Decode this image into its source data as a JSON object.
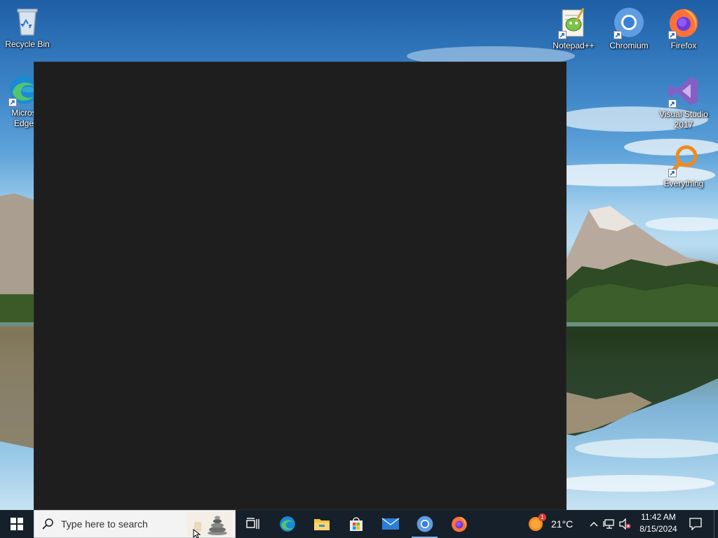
{
  "desktop": {
    "icons": [
      {
        "id": "recycle-bin",
        "label": "Recycle Bin",
        "icon": "recycle-bin-icon"
      },
      {
        "id": "edge",
        "label": "Micros\nEdge",
        "icon": "edge-icon"
      },
      {
        "id": "notepadpp",
        "label": "Notepad++",
        "icon": "notepadpp-icon"
      },
      {
        "id": "chromium",
        "label": "Chromium",
        "icon": "chromium-icon"
      },
      {
        "id": "firefox",
        "label": "Firefox",
        "icon": "firefox-icon"
      },
      {
        "id": "visual-studio",
        "label": "Visual Studio\n2017",
        "icon": "visual-studio-icon"
      },
      {
        "id": "everything",
        "label": "Everything",
        "icon": "everything-icon"
      }
    ]
  },
  "taskbar": {
    "search_placeholder": "Type here to search",
    "apps": [
      {
        "name": "Task View",
        "icon": "task-view-icon"
      },
      {
        "name": "Microsoft Edge",
        "icon": "edge-icon"
      },
      {
        "name": "File Explorer",
        "icon": "file-explorer-icon"
      },
      {
        "name": "Microsoft Store",
        "icon": "store-icon"
      },
      {
        "name": "Mail",
        "icon": "mail-icon"
      },
      {
        "name": "Chromium",
        "icon": "chromium-icon"
      },
      {
        "name": "Firefox",
        "icon": "firefox-icon"
      }
    ],
    "weather": {
      "temperature": "21°C",
      "badge": "1",
      "icon": "weather-sun-icon"
    },
    "tray": [
      "chevron-up-icon",
      "network-icon",
      "volume-muted-icon"
    ],
    "clock": {
      "time": "11:42 AM",
      "date": "8/15/2024"
    },
    "accent_colors": {
      "taskbar_bg": "#16202b",
      "window_bg": "#1e1e1e"
    }
  }
}
